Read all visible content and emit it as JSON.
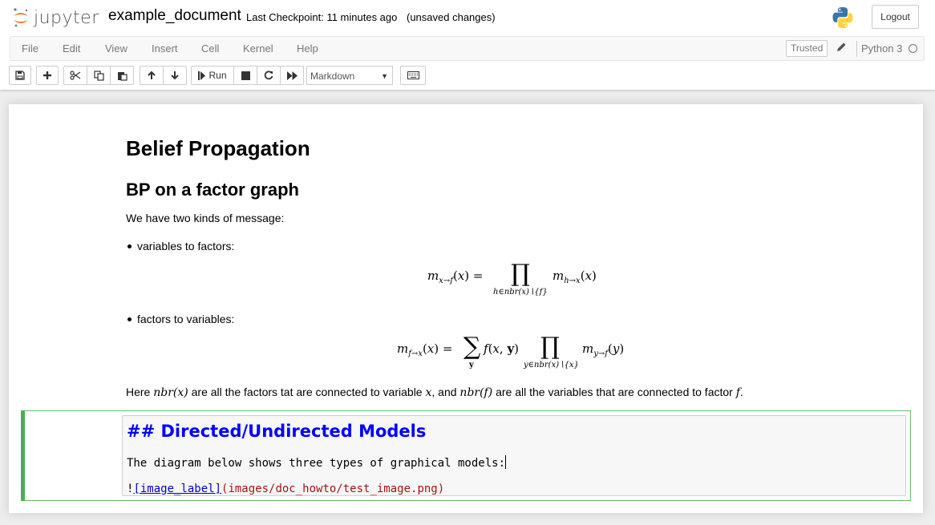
{
  "header": {
    "logo_text": "jupyter",
    "notebook_name": "example_document",
    "checkpoint": "Last Checkpoint: 11 minutes ago",
    "autosave": "(unsaved changes)",
    "logout_label": "Logout"
  },
  "menu": {
    "items": [
      "File",
      "Edit",
      "View",
      "Insert",
      "Cell",
      "Kernel",
      "Help"
    ],
    "trusted_label": "Trusted",
    "kernel_name": "Python 3"
  },
  "toolbar": {
    "run_label": "Run",
    "cell_type": "Markdown",
    "icons": [
      "save-icon",
      "plus-icon",
      "cut-icon",
      "copy-icon",
      "paste-icon",
      "arrow-up-icon",
      "arrow-down-icon",
      "run-icon",
      "stop-icon",
      "restart-icon",
      "fast-forward-icon",
      "keyboard-icon"
    ]
  },
  "notebook": {
    "h1": "Belief Propagation",
    "h2": "BP on a factor graph",
    "intro": "We have two kinds of message:",
    "bullet1": "variables to factors:",
    "bullet2": "factors to variables:",
    "here_text_1": "Here",
    "here_text_2": "are all the factors tat are connected to variable",
    "here_text_3": ", and",
    "here_text_4": "are all the variables that are connected to factor",
    "here_text_5": "."
  },
  "editor": {
    "line1": "## Directed/Undirected Models",
    "line2": "The diagram below shows three types of graphical models:",
    "line3_bang": "!",
    "line3_link": "[image_label]",
    "line3_url": "(images/doc_howto/test_image.png)"
  },
  "colors": {
    "accent_green": "#66bb6a",
    "header_blue": "#0000ff",
    "link_blue": "#0000cc",
    "url_red": "#aa1111",
    "jupyter_orange": "#f37726"
  }
}
